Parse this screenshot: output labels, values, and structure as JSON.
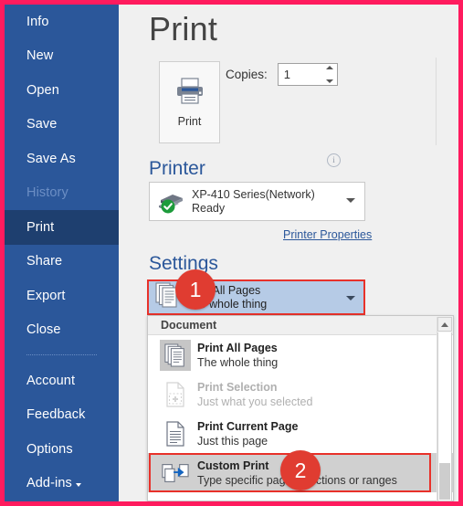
{
  "window": {
    "accent_border_color": "#ff1b5e",
    "background": "#f0f0f0"
  },
  "sidebar": {
    "background_color": "#2b579a",
    "active_color": "#1e3f6f",
    "items": [
      {
        "label": "Info",
        "state": "normal"
      },
      {
        "label": "New",
        "state": "normal"
      },
      {
        "label": "Open",
        "state": "normal"
      },
      {
        "label": "Save",
        "state": "normal"
      },
      {
        "label": "Save As",
        "state": "normal"
      },
      {
        "label": "History",
        "state": "disabled"
      },
      {
        "label": "Print",
        "state": "active"
      },
      {
        "label": "Share",
        "state": "normal"
      },
      {
        "label": "Export",
        "state": "normal"
      },
      {
        "label": "Close",
        "state": "normal"
      },
      {
        "label": "Account",
        "state": "normal"
      },
      {
        "label": "Feedback",
        "state": "normal"
      },
      {
        "label": "Options",
        "state": "normal"
      },
      {
        "label": "Add-ins",
        "state": "normal"
      }
    ]
  },
  "main": {
    "title": "Print",
    "print_button_label": "Print",
    "copies_label": "Copies:",
    "copies_value": "1",
    "printer": {
      "heading": "Printer",
      "name": "XP-410 Series(Network)",
      "status": "Ready",
      "properties_link": "Printer Properties",
      "status_color": "#1d9b3b"
    },
    "settings": {
      "heading": "Settings",
      "combo": {
        "primary": "Print All Pages",
        "secondary": "The whole thing",
        "highlight_color": "#e8312a",
        "background": "#b6cbe6"
      },
      "dropdown": {
        "group_header": "Document",
        "items": [
          {
            "primary": "Print All Pages",
            "secondary": "The whole thing",
            "state": "current"
          },
          {
            "primary": "Print Selection",
            "secondary": "Just what you selected",
            "state": "disabled"
          },
          {
            "primary": "Print Current Page",
            "secondary": "Just this page",
            "state": "normal"
          },
          {
            "primary": "Custom Print",
            "secondary": "Type specific pages, sections or ranges",
            "state": "highlighted"
          }
        ]
      }
    }
  },
  "badges": [
    {
      "number": "1",
      "color": "#e03c31"
    },
    {
      "number": "2",
      "color": "#e03c31"
    }
  ]
}
